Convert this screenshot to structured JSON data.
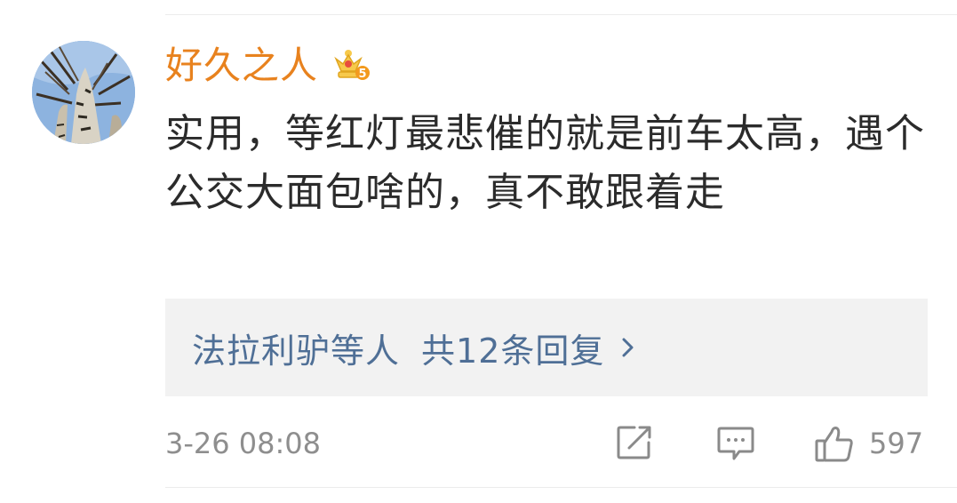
{
  "comment": {
    "username": "好久之人",
    "badge_icon": "crown-badge-icon",
    "badge_level": "5",
    "text": "实用，等红灯最悲催的就是前车太高，遇个公交大面包啥的，真不敢跟着走",
    "replies": {
      "names": "法拉利驴等人",
      "count_label": "共12条回复",
      "chevron_icon": "chevron-right-icon"
    },
    "timestamp": "3-26 08:08",
    "actions": {
      "share_icon": "share-edit-icon",
      "comment_icon": "comment-bubble-icon",
      "like_icon": "thumbs-up-icon",
      "like_count": "597"
    }
  },
  "colors": {
    "username": "#e8821e",
    "text": "#2b2b2b",
    "link": "#4f6f96",
    "muted": "#8e8e8e",
    "reply_bg": "#f2f2f2"
  }
}
